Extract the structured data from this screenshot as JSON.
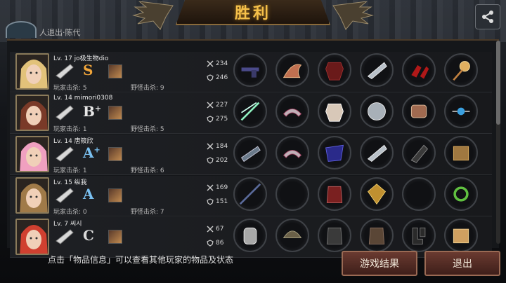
{
  "header": {
    "title": "胜利"
  },
  "top_player": {
    "name": "人退出·陈代"
  },
  "players": [
    {
      "level_name": "Lv. 17 jo极生物dio",
      "grade": "S",
      "grade_plus": "",
      "grade_color": "#f0a53a",
      "player_kills": "玩家击杀: 5",
      "monster_kills": "野怪击杀: 9",
      "attack": "234",
      "defense": "246",
      "avatar_color": "#c9a05a",
      "hair_color": "#e2c27a",
      "items": [
        "revolver",
        "wing-bow",
        "red-armor",
        "blade-gauntlet",
        "red-heels",
        "orb-staff"
      ]
    },
    {
      "level_name": "Lv. 14 mimori0308",
      "grade": "B",
      "grade_plus": "+",
      "grade_color": "#e8e8e8",
      "player_kills": "玩家击杀: 1",
      "monster_kills": "野怪击杀: 5",
      "attack": "227",
      "defense": "275",
      "avatar_color": "#b07050",
      "hair_color": "#7a3a28",
      "items": [
        "twin-swords",
        "tiara",
        "white-armor",
        "silver-disc",
        "ornate-bracer",
        "blue-amulet"
      ]
    },
    {
      "level_name": "Lv. 14 唐筱欣",
      "grade": "A",
      "grade_plus": "+",
      "grade_color": "#7ac0f0",
      "player_kills": "玩家击杀: 1",
      "monster_kills": "野怪击杀: 6",
      "attack": "184",
      "defense": "202",
      "avatar_color": "#e0a0b8",
      "hair_color": "#f0a0c0",
      "items": [
        "gun-blade",
        "tiara",
        "blue-cloak",
        "blade-gauntlet",
        "dark-gauntlet",
        "wood-crate"
      ]
    },
    {
      "level_name": "Lv. 15 纵我",
      "grade": "A",
      "grade_plus": "",
      "grade_color": "#7ac0f0",
      "player_kills": "玩家击杀: 0",
      "monster_kills": "野怪击杀: 7",
      "attack": "169",
      "defense": "151",
      "avatar_color": "#b08a60",
      "hair_color": "#a07a48",
      "items": [
        "spear",
        "empty",
        "red-vest",
        "golden-shield",
        "empty",
        "green-bracelet"
      ]
    },
    {
      "level_name": "Lv. 7 씨시",
      "grade": "C",
      "grade_plus": "",
      "grade_color": "#d8d8d8",
      "player_kills": "",
      "monster_kills": "",
      "attack": "67",
      "defense": "86",
      "avatar_color": "#a04030",
      "hair_color": "#d04030",
      "items": [
        "gauntlet",
        "helmet",
        "dark-vest",
        "leather-armor",
        "boots",
        "cardboard-box"
      ]
    }
  ],
  "footer": {
    "hint": "点击「物品信息」可以查看其他玩家的物品及状态",
    "results_button": "游戏结果",
    "exit_button": "退出"
  },
  "colors": {
    "title": "#f5c04a",
    "button": "#6a3a30",
    "panel": "#15171a"
  }
}
